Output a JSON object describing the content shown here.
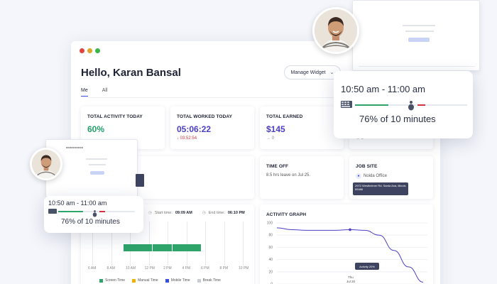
{
  "window": {
    "dot_colors": [
      "#e0443e",
      "#e0a528",
      "#3cb54a"
    ],
    "greeting": "Hello, Karan Bansal",
    "manage_label": "Manage Widget",
    "tabs": [
      {
        "label": "Me"
      },
      {
        "label": "All"
      }
    ]
  },
  "stats": {
    "activity": {
      "label": "TOTAL ACTIVITY TODAY",
      "value": "60%"
    },
    "worked": {
      "label": "TOTAL WORKED TODAY",
      "value": "05:06:22",
      "delta": "03:52:54"
    },
    "earned": {
      "label": "TOTAL EARNED",
      "value": "$145",
      "delta": "0"
    },
    "fourth": {
      "delta": "0"
    }
  },
  "time_off": {
    "label": "TIME OFF",
    "text": "8.5 hrs leave on Jul 25."
  },
  "job_site": {
    "label": "JOB SITE",
    "office": "Noida Office",
    "address": "2972 Westheimer Rd. Santa Ana, Illinois 85486"
  },
  "timeline": {
    "start_label": "Start time:",
    "start_value": "09:09 AM",
    "end_label": "End time:",
    "end_value": "06:10 PM",
    "x_ticks": [
      "6 AM",
      "8 AM",
      "10 AM",
      "12 PM",
      "2 PM",
      "4 PM",
      "6 PM",
      "8 PM",
      "10 PM"
    ],
    "legend": [
      {
        "label": "Screen Time",
        "color": "#2ea36a"
      },
      {
        "label": "Manual Time",
        "color": "#f0b400"
      },
      {
        "label": "Mobile Time",
        "color": "#3b4de0"
      },
      {
        "label": "Break Time",
        "color": "#c9ccd4"
      }
    ]
  },
  "activity_graph": {
    "label": "ACTIVITY GRAPH",
    "y_ticks": [
      "100",
      "80",
      "60",
      "40",
      "20",
      "0"
    ],
    "tooltip": "Activity 20%",
    "x_label_1": "Thu",
    "x_label_2": "Jul 20"
  },
  "chart_data": {
    "type": "line",
    "title": "ACTIVITY GRAPH",
    "ylim": [
      0,
      100
    ],
    "y_ticks": [
      100,
      80,
      60,
      40,
      20,
      0
    ],
    "series": [
      {
        "values": [
          92,
          89,
          88,
          88,
          88,
          89,
          88,
          80,
          55,
          28,
          3
        ]
      }
    ]
  },
  "right_popup": {
    "time_range": "10:50 am - 11:00 am",
    "activity_text": "76% of 10 minutes",
    "keyboard_progress": 0.55,
    "mouse_progress": 0.15
  },
  "left_popup": {
    "time_range": "10:50 am - 11:00 am",
    "activity_text": "76% of 10 minutes",
    "keyboard_progress": 0.55,
    "mouse_progress": 0.15
  },
  "colors": {
    "accent": "#4b3fc4",
    "green": "#22a06b",
    "bar_green": "#2ea36a",
    "red": "#d0353f"
  }
}
